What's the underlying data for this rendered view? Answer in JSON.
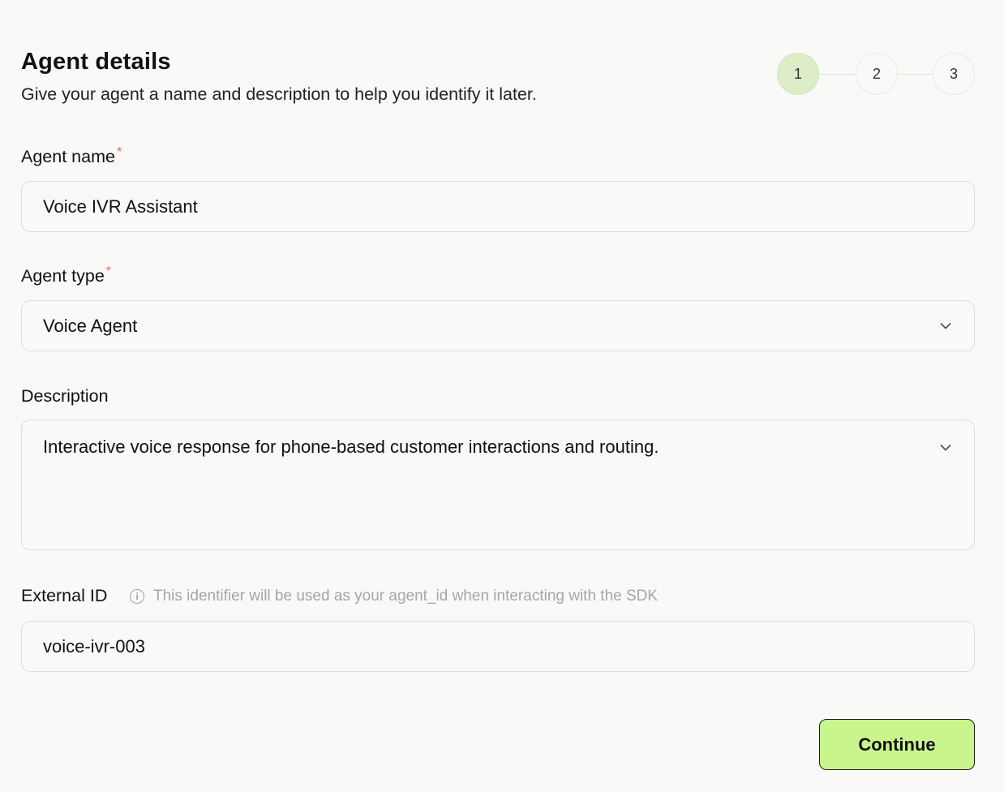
{
  "header": {
    "title": "Agent details",
    "subtitle": "Give your agent a name and description to help you identify it later."
  },
  "stepper": {
    "steps": [
      "1",
      "2",
      "3"
    ],
    "active_step": 1
  },
  "form": {
    "agent_name": {
      "label": "Agent name",
      "required_mark": "*",
      "value": "Voice IVR Assistant"
    },
    "agent_type": {
      "label": "Agent type",
      "required_mark": "*",
      "value": "Voice Agent"
    },
    "description": {
      "label": "Description",
      "value": "Interactive voice response for phone-based customer interactions and routing."
    },
    "external_id": {
      "label": "External ID",
      "info_glyph": "i",
      "hint": "This identifier will be used as your agent_id when interacting with the SDK",
      "value": "voice-ivr-003"
    }
  },
  "actions": {
    "continue_label": "Continue"
  },
  "colors": {
    "accent": "#c9f58d",
    "active_step_bg": "#dcedc8",
    "required": "#e46a6a"
  }
}
